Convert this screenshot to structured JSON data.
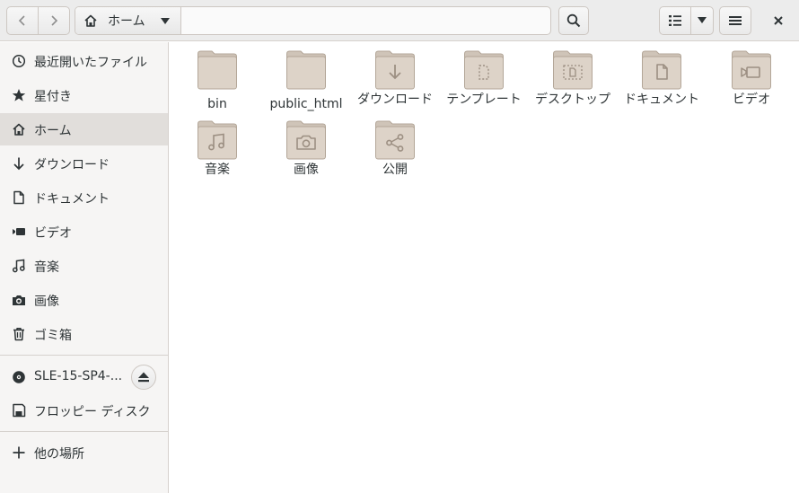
{
  "toolbar": {
    "path_home_label": "ホーム"
  },
  "sidebar": {
    "items": [
      {
        "label": "最近開いたファイル",
        "icon": "clock-icon"
      },
      {
        "label": "星付き",
        "icon": "star-icon"
      },
      {
        "label": "ホーム",
        "icon": "home-icon",
        "active": true
      },
      {
        "label": "ダウンロード",
        "icon": "arrow-down-icon"
      },
      {
        "label": "ドキュメント",
        "icon": "document-icon"
      },
      {
        "label": "ビデオ",
        "icon": "video-icon"
      },
      {
        "label": "音楽",
        "icon": "music-icon"
      },
      {
        "label": "画像",
        "icon": "camera-icon"
      },
      {
        "label": "ゴミ箱",
        "icon": "trash-icon"
      }
    ],
    "devices": [
      {
        "label": "SLE-15-SP4-...",
        "icon": "disc-icon"
      },
      {
        "label": "フロッピー ディスク",
        "icon": "floppy-icon"
      }
    ],
    "other": {
      "label": "他の場所",
      "icon": "plus-icon"
    }
  },
  "files": [
    {
      "name": "bin",
      "emblem": "none"
    },
    {
      "name": "public_html",
      "emblem": "none"
    },
    {
      "name": "ダウンロード",
      "emblem": "download"
    },
    {
      "name": "テンプレート",
      "emblem": "template"
    },
    {
      "name": "デスクトップ",
      "emblem": "desktop"
    },
    {
      "name": "ドキュメント",
      "emblem": "document"
    },
    {
      "name": "ビデオ",
      "emblem": "video"
    },
    {
      "name": "音楽",
      "emblem": "music"
    },
    {
      "name": "画像",
      "emblem": "camera"
    },
    {
      "name": "公開",
      "emblem": "share"
    }
  ],
  "colors": {
    "folder_body": "#ddd3c8",
    "folder_tab": "#cfc4b8",
    "folder_stroke": "#b3a698",
    "emblem": "#9c8f82",
    "sidebar_bg": "#f6f5f4",
    "sidebar_active": "#e1dedb",
    "headerbar_bg": "#ececec"
  }
}
